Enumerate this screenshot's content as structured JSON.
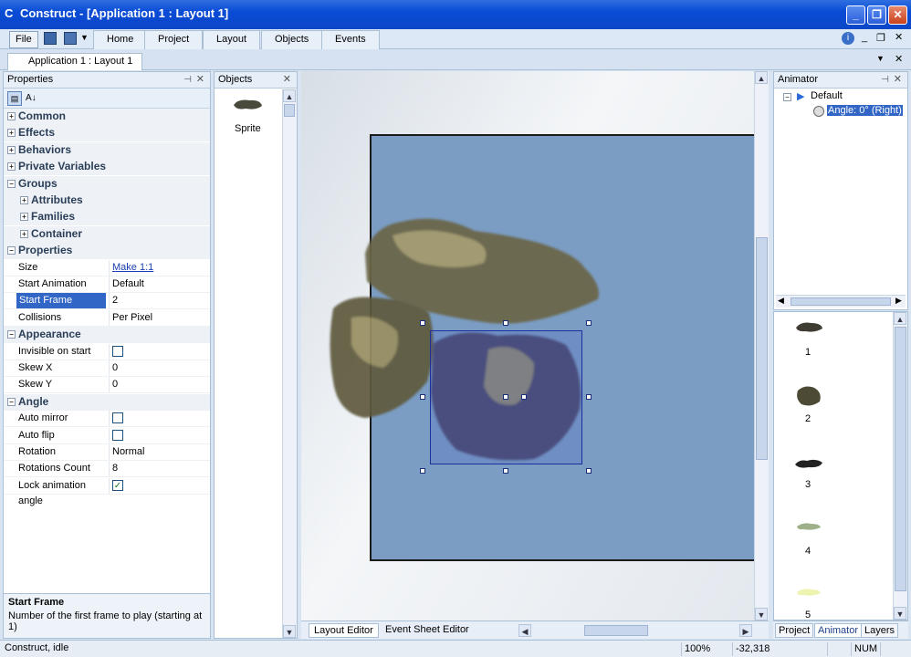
{
  "window": {
    "title": "Construct - [Application 1 : Layout 1]"
  },
  "menu": {
    "file": "File",
    "tabs": [
      "Home",
      "Project",
      "Layout",
      "Objects",
      "Events"
    ]
  },
  "document_tab": "Application 1 : Layout 1",
  "properties": {
    "header": "Properties",
    "rows": [
      {
        "kind": "cat",
        "label": "Common"
      },
      {
        "kind": "cat",
        "label": "Effects"
      },
      {
        "kind": "cat",
        "label": "Behaviors"
      },
      {
        "kind": "cat",
        "label": "Private Variables"
      },
      {
        "kind": "cat",
        "label": "Groups",
        "expanded": true
      },
      {
        "kind": "sub",
        "label": "Attributes"
      },
      {
        "kind": "sub",
        "label": "Families"
      },
      {
        "kind": "sub",
        "label": "Container"
      },
      {
        "kind": "cat",
        "label": "Properties",
        "expanded": true
      },
      {
        "kind": "prop",
        "label": "Size",
        "value": "Make 1:1",
        "link": true
      },
      {
        "kind": "prop",
        "label": "Start Animation",
        "value": "Default"
      },
      {
        "kind": "prop",
        "label": "Start Frame",
        "value": "2",
        "selected": true
      },
      {
        "kind": "prop",
        "label": "Collisions",
        "value": "Per Pixel"
      },
      {
        "kind": "cat",
        "label": "Appearance",
        "expanded": true
      },
      {
        "kind": "prop",
        "label": "Invisible on start",
        "check": false
      },
      {
        "kind": "prop",
        "label": "Skew X",
        "value": "0"
      },
      {
        "kind": "prop",
        "label": "Skew Y",
        "value": "0"
      },
      {
        "kind": "cat",
        "label": "Angle",
        "expanded": true
      },
      {
        "kind": "prop",
        "label": "Auto mirror",
        "check": false
      },
      {
        "kind": "prop",
        "label": "Auto flip",
        "check": false
      },
      {
        "kind": "prop",
        "label": "Rotation",
        "value": "Normal"
      },
      {
        "kind": "prop",
        "label": "Rotations Count",
        "value": "8"
      },
      {
        "kind": "prop",
        "label": "Lock animation angle",
        "check": true
      }
    ],
    "description_title": "Start Frame",
    "description_text": "Number of the first frame to play (starting at 1)"
  },
  "objects": {
    "header": "Objects",
    "items": [
      "Sprite"
    ]
  },
  "layout_tabs": [
    "Layout Editor",
    "Event Sheet Editor"
  ],
  "animator": {
    "header": "Animator",
    "tree_root": "Default",
    "tree_child": "Angle: 0° (Right)",
    "frames": [
      "1",
      "2",
      "3",
      "4",
      "5"
    ]
  },
  "right_tabs": [
    "Project",
    "Animator",
    "Layers"
  ],
  "status": {
    "text": "Construct, idle",
    "zoom": "100%",
    "coords": "-32,318",
    "num": "NUM"
  },
  "colors": {
    "canvas": "#7b9dc3",
    "selection": "#1c2f9a",
    "titlebar": "#0a4bd6"
  }
}
